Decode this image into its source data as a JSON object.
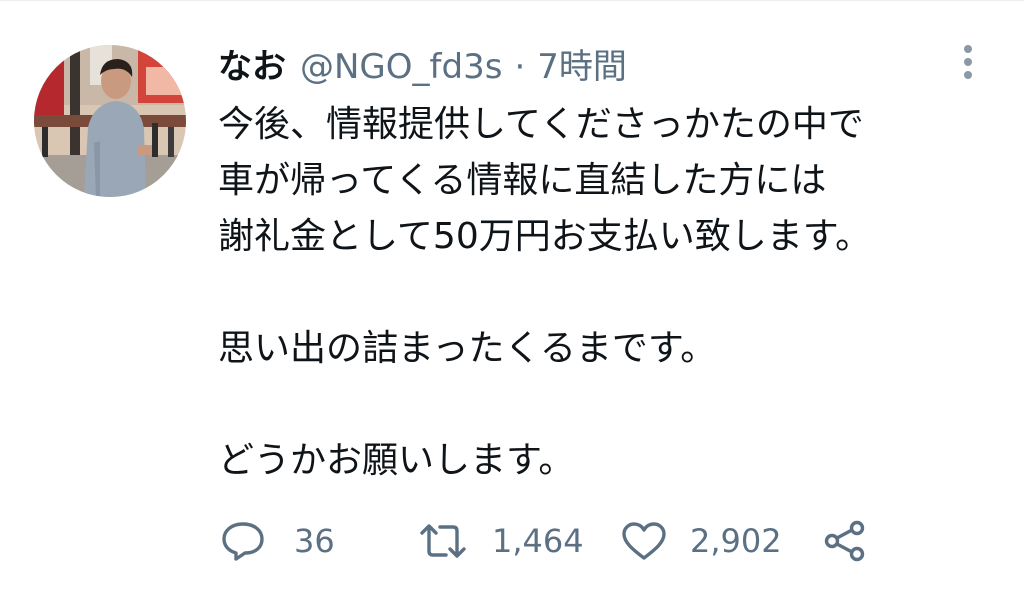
{
  "tweet": {
    "display_name": "なお",
    "handle": "@NGO_fd3s",
    "separator": "·",
    "time": "7時間",
    "body_lines": [
      "今後、情報提供してくださっかたの中で",
      "車が帰ってくる情報に直結した方には",
      "謝礼金として50万円お支払い致します。",
      "",
      "思い出の詰まったくるまです。",
      "",
      "どうかお願いします。"
    ],
    "actions": {
      "reply": {
        "icon": "reply-icon",
        "count": "36"
      },
      "retweet": {
        "icon": "retweet-icon",
        "count": "1,464"
      },
      "like": {
        "icon": "heart-icon",
        "count": "2,902"
      },
      "share": {
        "icon": "share-icon"
      }
    },
    "more_icon": "more-vertical-icon"
  },
  "colors": {
    "text": "#0f1419",
    "secondary": "#5b7083",
    "divider": "#eceff1"
  }
}
